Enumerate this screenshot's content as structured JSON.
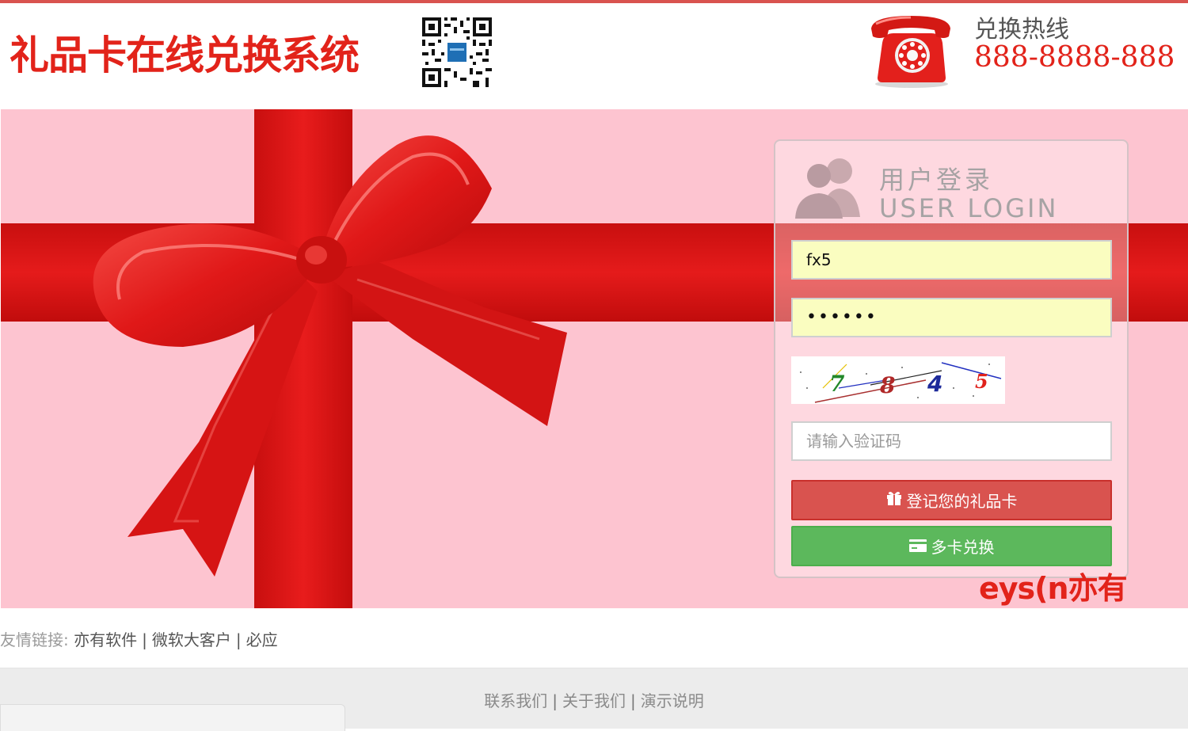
{
  "header": {
    "title": "礼品卡在线兑换系统",
    "hotline_label": "兑换热线",
    "hotline_number": "888-8888-888",
    "qr_icon": "qr-code-icon",
    "phone_icon": "telephone-icon"
  },
  "login": {
    "heading_cn": "用户登录",
    "heading_en": "USER LOGIN",
    "username_value": "fx5",
    "password_value": "••••••",
    "captcha_digits": [
      "7",
      "8",
      "4",
      "5"
    ],
    "captcha_placeholder": "请输入验证码",
    "register_button": "登记您的礼品卡",
    "multi_button": "多卡兑换",
    "brand": "eys(n亦有"
  },
  "links": {
    "label": "友情链接:",
    "items": [
      "亦有软件",
      "微软大客户",
      "必应"
    ]
  },
  "footer": {
    "items": [
      "联系我们",
      "关于我们",
      "演示说明"
    ]
  },
  "colors": {
    "brand_red": "#e2231a",
    "banner_pink": "#fdc4d0",
    "register_red": "#d9534f",
    "multi_green": "#5cb85c",
    "input_yellow": "#fafdc0"
  }
}
